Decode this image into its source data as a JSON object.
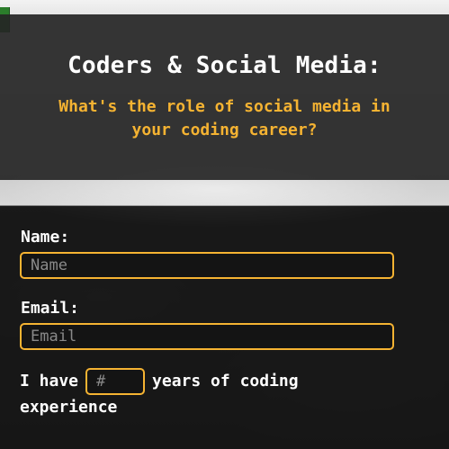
{
  "header": {
    "title": "Coders & Social Media:",
    "subtitle": "What's the role of social media in your coding career?"
  },
  "form": {
    "name_label": "Name:",
    "name_placeholder": "Name",
    "email_label": "Email:",
    "email_placeholder": "Email",
    "experience_prefix": "I have",
    "experience_placeholder": "#",
    "experience_suffix": "years of coding experience"
  },
  "colors": {
    "accent": "#f5b332",
    "panel": "#252525",
    "text": "#ffffff"
  }
}
